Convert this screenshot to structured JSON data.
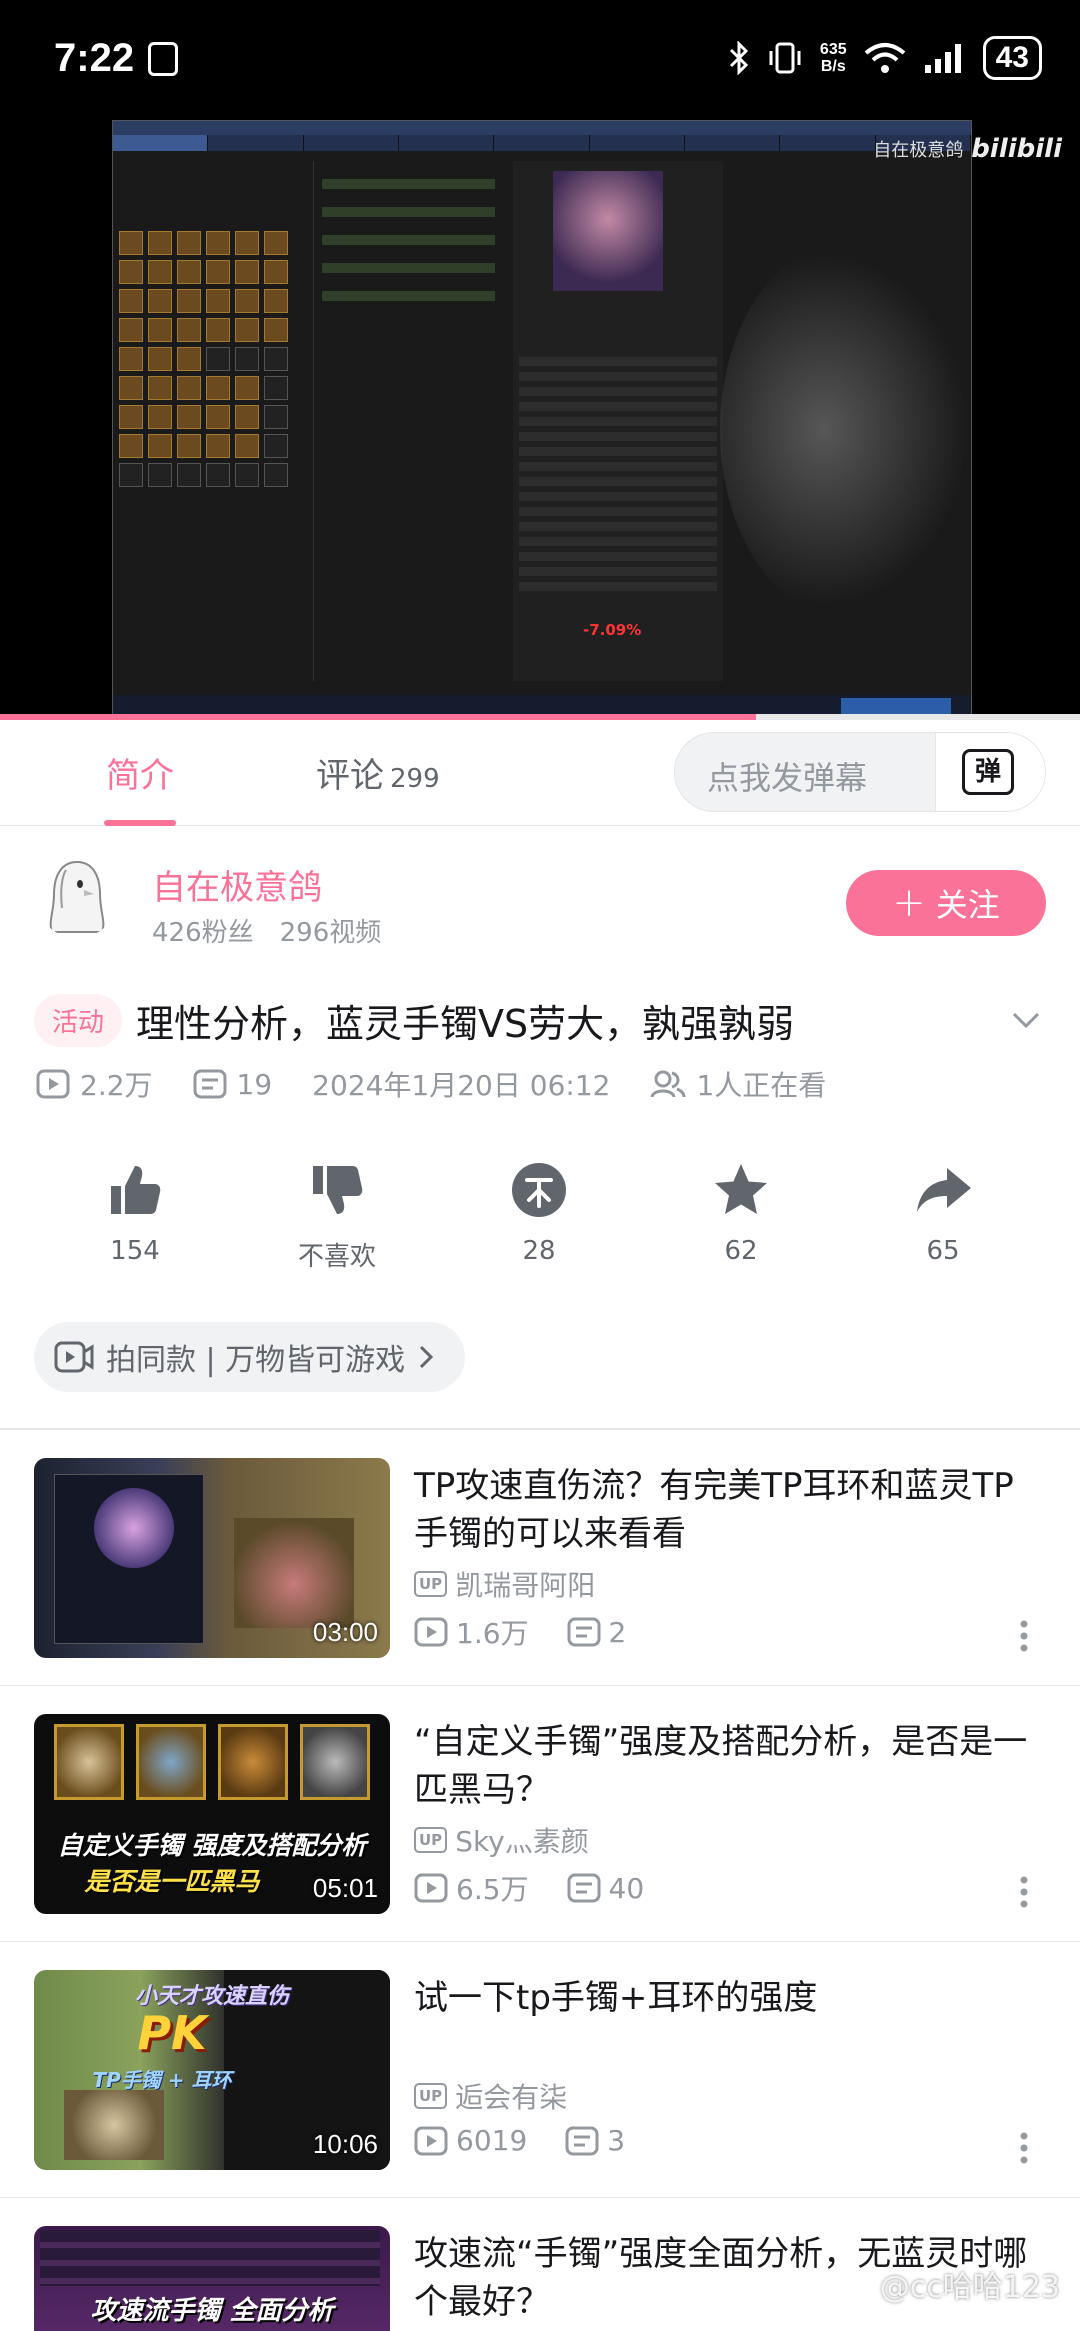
{
  "status_bar": {
    "time": "7:22",
    "net_speed_value": "635",
    "net_speed_unit": "B/s",
    "battery": "43"
  },
  "video": {
    "watermark_author": "自在极意鸽",
    "watermark_brand": "bilibili",
    "damage_delta": "-7.09%",
    "progress_fraction": 0.7
  },
  "tabs": {
    "intro": "简介",
    "comments": "评论",
    "comments_count": "299"
  },
  "danmaku": {
    "placeholder": "点我发弹幕",
    "button_glyph": "弹"
  },
  "uploader": {
    "name": "自在极意鸽",
    "fans": "426粉丝",
    "videos": "296视频",
    "follow_label": "关注"
  },
  "video_info": {
    "badge": "活动",
    "title": "理性分析，蓝灵手镯VS劳大，孰强孰弱",
    "views": "2.2万",
    "danmaku_count": "19",
    "date": "2024年1月20日 06:12",
    "watching": "1人正在看"
  },
  "actions": {
    "like": "154",
    "dislike": "不喜欢",
    "coin": "28",
    "favorite": "62",
    "share": "65"
  },
  "same_style": {
    "label": "拍同款 | 万物皆可游戏"
  },
  "recommendations": [
    {
      "title": "TP攻速直伤流？有完美TP耳环和蓝灵TP手镯的可以来看看",
      "author": "凯瑞哥阿阳",
      "views": "1.6万",
      "danmaku": "2",
      "duration": "03:00"
    },
    {
      "title": "“自定义手镯”强度及搭配分析，是否是一匹黑马？",
      "author": "Sky灬素颜",
      "views": "6.5万",
      "danmaku": "40",
      "duration": "05:01",
      "thumb_line1": "自定义手镯 强度及搭配分析",
      "thumb_line2": "是否是一匹黑马"
    },
    {
      "title": "试一下tp手镯+耳环的强度",
      "author": "逅会有柒",
      "views": "6019",
      "danmaku": "3",
      "duration": "10:06",
      "thumb_line1": "小天才攻速直伤",
      "thumb_line2": "PK",
      "thumb_line3": "TP手镯 + 耳环"
    },
    {
      "title": "攻速流“手镯”强度全面分析，无蓝灵时哪个最好？",
      "thumb_line1": "攻速流手镯 全面分析"
    }
  ],
  "watermark": "@cc哈哈123",
  "colors": {
    "accent": "#fb7299",
    "text_primary": "#18191c",
    "text_secondary": "#9499a0"
  }
}
